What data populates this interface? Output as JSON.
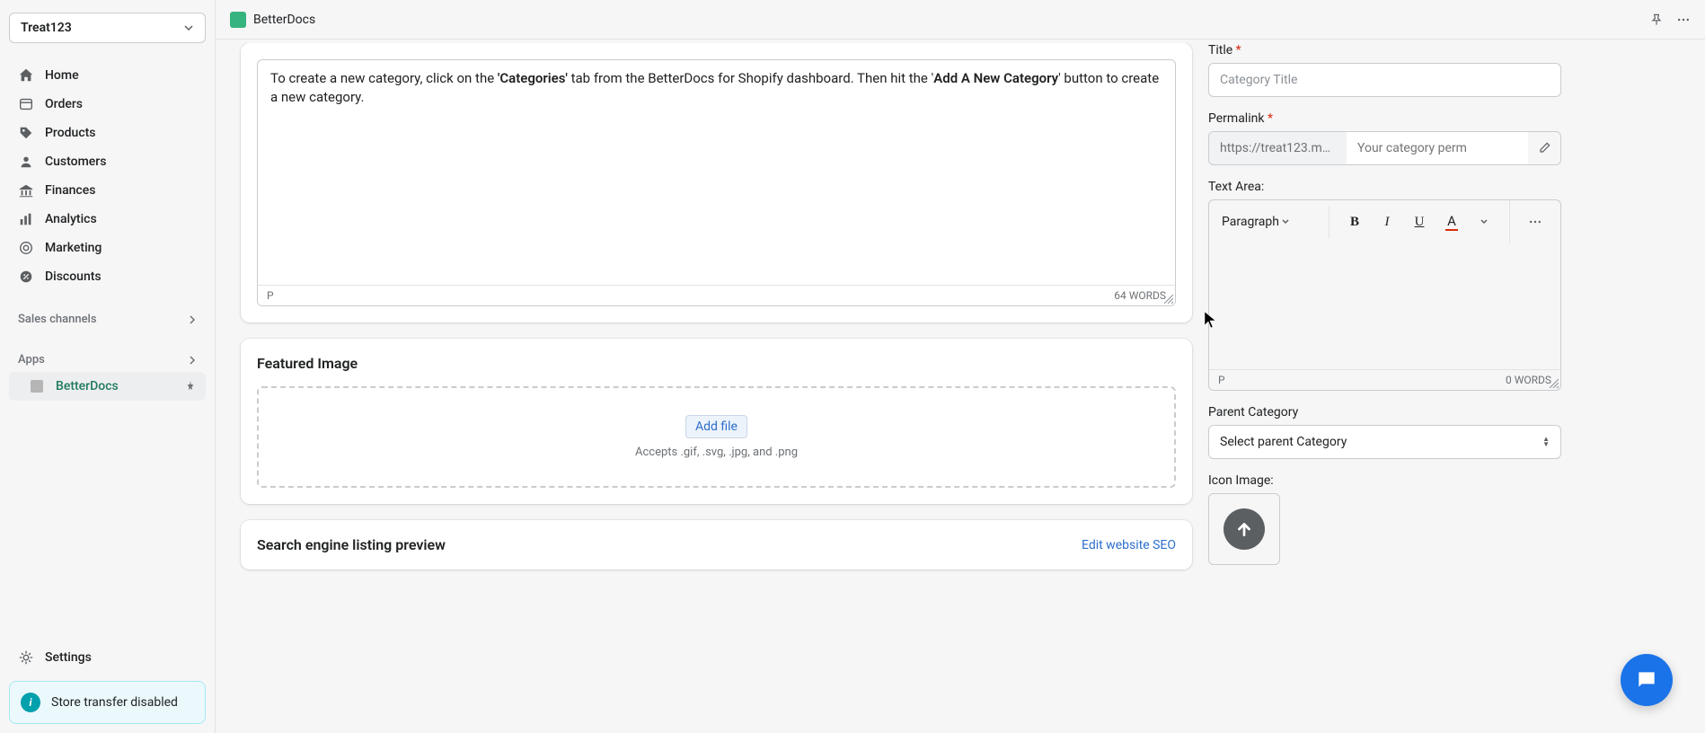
{
  "store_name": "Treat123",
  "nav": {
    "home": "Home",
    "orders": "Orders",
    "products": "Products",
    "customers": "Customers",
    "finances": "Finances",
    "analytics": "Analytics",
    "marketing": "Marketing",
    "discounts": "Discounts"
  },
  "sections": {
    "sales_channels": "Sales channels",
    "apps": "Apps"
  },
  "app_item": "BetterDocs",
  "settings": "Settings",
  "alert": "Store transfer disabled",
  "top_app": "BetterDocs",
  "editor": {
    "text_before_bold1": "To create a new category, click on the ",
    "bold1": "'Categories'",
    "text_mid": " tab from the BetterDocs for Shopify dashboard. Then hit the '",
    "bold2": "Add A New Category",
    "text_after": "' button to create a new category.",
    "path": "P",
    "wordcount": "64 WORDS"
  },
  "featured": {
    "title": "Featured Image",
    "add": "Add file",
    "accepts": "Accepts .gif, .svg, .jpg, and .png"
  },
  "seo": {
    "title": "Search engine listing preview",
    "edit": "Edit website SEO"
  },
  "form": {
    "title_label": "Title",
    "title_placeholder": "Category Title",
    "permalink_label": "Permalink",
    "permalink_prefix": "https://treat123.myshopify....",
    "permalink_placeholder": "Your category perm",
    "textarea_label": "Text Area:",
    "paragraph": "Paragraph",
    "rte_path": "P",
    "rte_words": "0 WORDS",
    "parent_label": "Parent Category",
    "parent_placeholder": "Select parent Category",
    "icon_label": "Icon Image:"
  }
}
